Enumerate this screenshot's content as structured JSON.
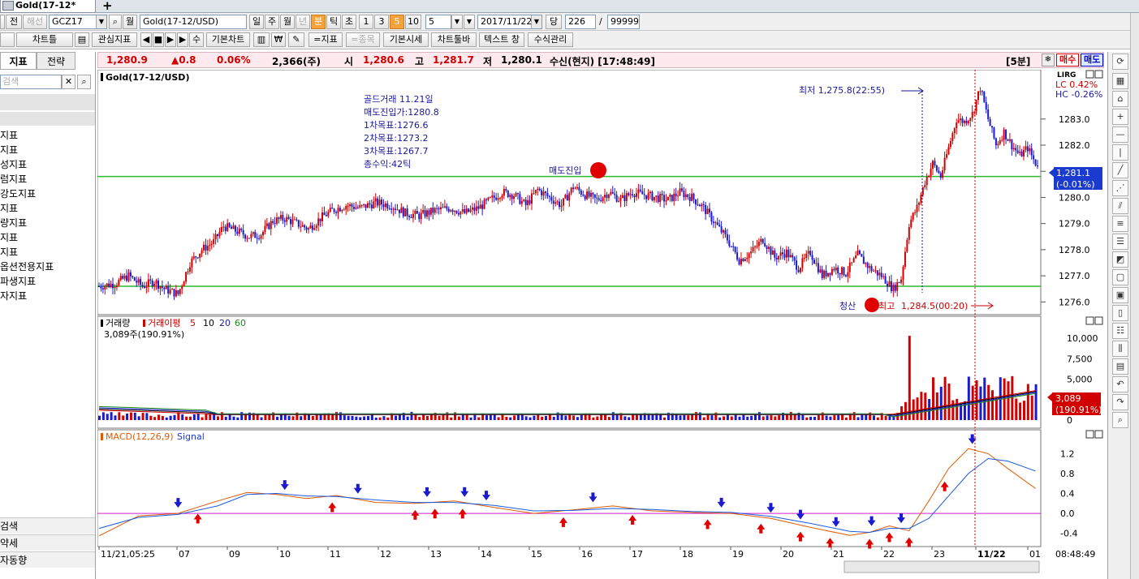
{
  "window": {
    "tab_title": "Gold(17-12*",
    "new_tab_symbol": "+"
  },
  "toolbar1": {
    "buttons": [
      "전",
      "해선",
      "월",
      "일",
      "주",
      "월",
      "년",
      "분",
      "틱",
      "초",
      "1",
      "3",
      "5",
      "10",
      "당"
    ],
    "symbol_code": "GCZ17",
    "symbol_name": "Gold(17-12/USD)",
    "period_value": "5",
    "date_value": "2017/11/22",
    "count_value": "226",
    "count_sep": "/",
    "max_count": "99999",
    "selected_unit": "분",
    "selected_interval": "5"
  },
  "toolbar2": {
    "buttons": [
      "차트틀",
      "관심지표",
      "수",
      "기본차트",
      "₩",
      "=지표",
      "=종목",
      "기본시세",
      "차트툴바",
      "텍스트 창",
      "수식관리"
    ]
  },
  "quote": {
    "price": "1,280.9",
    "change": "▲0.8",
    "change_pct": "0.06%",
    "volume": "2,366(주)",
    "open_label": "시",
    "open": "1,280.6",
    "high_label": "고",
    "high": "1,281.7",
    "low_label": "저",
    "low": "1,280.1",
    "status": "수신(현지) [17:48:49]",
    "interval_badge": "[5분]",
    "sell_label": "매수",
    "buy_label": "매도"
  },
  "left_panel": {
    "tabs": [
      "지표",
      "전략"
    ],
    "search_placeholder": "검색",
    "items": [
      "지표",
      "지표",
      "성지표",
      "럼지표",
      "강도지표",
      "지표",
      "량지표",
      "지표",
      "지표",
      "옵션전용지표",
      "파생지표",
      "자지표"
    ],
    "bottom_items": [
      "검색",
      "약세",
      "자동향"
    ]
  },
  "chart_header": {
    "symbol_label": "Gold(17-12/USD)",
    "legend_lc": "LC  0.42%",
    "legend_hc": "HC -0.26%",
    "current_price": "1,281.1",
    "current_pct": "(-0.01%)"
  },
  "annotations": {
    "strategy_text": [
      "골드거래  11.21일",
      "매도진입가:1280.8",
      "1차목표:1276.6",
      "2차목표:1273.2",
      "3차목표:1267.7",
      "총수익:42틱"
    ],
    "sell_entry": "매도진입",
    "low_marker": "최저 1,275.8(22:55)",
    "liquidate": "청산",
    "high_marker_prefix": "최고",
    "high_marker": "1,284.5(00:20)"
  },
  "volume_panel": {
    "title": "거래량",
    "ma_label": "거래이평",
    "ma_periods": [
      "5",
      "10",
      "20",
      "60"
    ],
    "value_text": "3,089주(190.91%)",
    "current_value": "3,089",
    "current_pct": "(190.91%)",
    "axis_labels": [
      "10,000",
      "7,500",
      "5,000",
      "2,500",
      "0"
    ]
  },
  "macd_panel": {
    "title": "MACD(12,26,9)",
    "signal_label": "Signal",
    "axis_labels": [
      "1.2",
      "0.8",
      "0.4",
      "0.0",
      "-0.4"
    ]
  },
  "time_axis": {
    "labels": [
      "11/21,05:25",
      "07",
      "09",
      "10",
      "11",
      "12",
      "13",
      "14",
      "15",
      "16",
      "17",
      "18",
      "19",
      "20",
      "21",
      "22",
      "23",
      "11/22",
      "01"
    ],
    "clock": "08:48:49"
  },
  "chart_data": {
    "type": "candlestick",
    "symbol": "Gold(17-12/USD)",
    "interval": "5분",
    "price_axis": [
      1276.0,
      1277.0,
      1278.0,
      1279.0,
      1280.0,
      1281.0,
      1282.0,
      1283.0
    ],
    "ylim": [
      1275.7,
      1284.7
    ],
    "horizontal_lines": [
      1280.8,
      1276.6
    ],
    "close_path": [
      [
        0,
        1276.6
      ],
      [
        8,
        1276.7
      ],
      [
        15,
        1277.0
      ],
      [
        22,
        1276.6
      ],
      [
        28,
        1276.8
      ],
      [
        33,
        1276.5
      ],
      [
        40,
        1276.3
      ],
      [
        46,
        1277.5
      ],
      [
        52,
        1278.0
      ],
      [
        58,
        1278.3
      ],
      [
        63,
        1278.9
      ],
      [
        70,
        1278.7
      ],
      [
        76,
        1278.5
      ],
      [
        82,
        1278.6
      ],
      [
        88,
        1279.1
      ],
      [
        94,
        1279.2
      ],
      [
        100,
        1279.0
      ],
      [
        106,
        1278.8
      ],
      [
        112,
        1279.2
      ],
      [
        118,
        1279.5
      ],
      [
        125,
        1279.7
      ],
      [
        132,
        1279.6
      ],
      [
        140,
        1279.8
      ],
      [
        148,
        1279.7
      ],
      [
        155,
        1279.4
      ],
      [
        162,
        1279.3
      ],
      [
        170,
        1279.5
      ],
      [
        178,
        1279.6
      ],
      [
        185,
        1279.4
      ],
      [
        192,
        1279.6
      ],
      [
        198,
        1279.9
      ],
      [
        204,
        1280.2
      ],
      [
        210,
        1280.1
      ],
      [
        216,
        1279.7
      ],
      [
        222,
        1280.3
      ],
      [
        228,
        1280.0
      ],
      [
        234,
        1279.7
      ],
      [
        240,
        1280.4
      ],
      [
        246,
        1280.1
      ],
      [
        252,
        1279.9
      ],
      [
        258,
        1280.2
      ],
      [
        264,
        1279.9
      ],
      [
        270,
        1280.2
      ],
      [
        276,
        1280.1
      ],
      [
        282,
        1280.0
      ],
      [
        288,
        1279.9
      ],
      [
        294,
        1280.2
      ],
      [
        300,
        1280.0
      ],
      [
        306,
        1279.6
      ],
      [
        312,
        1279.0
      ],
      [
        318,
        1278.4
      ],
      [
        324,
        1277.6
      ],
      [
        330,
        1277.9
      ],
      [
        336,
        1278.4
      ],
      [
        342,
        1277.7
      ],
      [
        348,
        1277.9
      ],
      [
        354,
        1277.3
      ],
      [
        360,
        1277.9
      ],
      [
        366,
        1277.0
      ],
      [
        372,
        1277.3
      ],
      [
        378,
        1277.1
      ],
      [
        384,
        1277.8
      ],
      [
        390,
        1277.3
      ],
      [
        396,
        1277.0
      ],
      [
        402,
        1276.5
      ],
      [
        406,
        1276.9
      ],
      [
        410,
        1279.0
      ],
      [
        414,
        1279.6
      ],
      [
        418,
        1280.6
      ],
      [
        422,
        1281.3
      ],
      [
        426,
        1280.8
      ],
      [
        430,
        1281.9
      ],
      [
        434,
        1283.0
      ],
      [
        438,
        1282.9
      ],
      [
        442,
        1283.2
      ],
      [
        446,
        1284.2
      ],
      [
        450,
        1283.0
      ],
      [
        454,
        1282.0
      ],
      [
        458,
        1282.5
      ],
      [
        462,
        1282.0
      ],
      [
        466,
        1281.6
      ],
      [
        470,
        1281.9
      ],
      [
        474,
        1281.3
      ]
    ],
    "volume_axis": [
      0,
      2500,
      5000,
      7500,
      10000
    ],
    "volume_current": 3089,
    "macd_axis": [
      -0.4,
      0.0,
      0.4,
      0.8,
      1.2
    ],
    "macd": [
      [
        0,
        -0.45
      ],
      [
        20,
        -0.05
      ],
      [
        40,
        0.0
      ],
      [
        60,
        0.25
      ],
      [
        75,
        0.42
      ],
      [
        90,
        0.38
      ],
      [
        105,
        0.3
      ],
      [
        120,
        0.36
      ],
      [
        140,
        0.22
      ],
      [
        160,
        0.2
      ],
      [
        180,
        0.25
      ],
      [
        200,
        0.12
      ],
      [
        220,
        0.0
      ],
      [
        240,
        0.07
      ],
      [
        260,
        0.15
      ],
      [
        280,
        0.05
      ],
      [
        300,
        0.02
      ],
      [
        320,
        0.0
      ],
      [
        340,
        -0.1
      ],
      [
        360,
        -0.28
      ],
      [
        380,
        -0.44
      ],
      [
        390,
        -0.38
      ],
      [
        400,
        -0.25
      ],
      [
        410,
        -0.35
      ],
      [
        420,
        0.25
      ],
      [
        430,
        0.9
      ],
      [
        440,
        1.3
      ],
      [
        450,
        1.2
      ],
      [
        460,
        0.9
      ],
      [
        474,
        0.5
      ]
    ],
    "signal": [
      [
        0,
        -0.3
      ],
      [
        20,
        -0.08
      ],
      [
        40,
        -0.02
      ],
      [
        60,
        0.15
      ],
      [
        75,
        0.38
      ],
      [
        90,
        0.4
      ],
      [
        105,
        0.35
      ],
      [
        120,
        0.34
      ],
      [
        140,
        0.27
      ],
      [
        160,
        0.22
      ],
      [
        180,
        0.22
      ],
      [
        200,
        0.16
      ],
      [
        220,
        0.05
      ],
      [
        240,
        0.06
      ],
      [
        260,
        0.1
      ],
      [
        280,
        0.08
      ],
      [
        300,
        0.04
      ],
      [
        320,
        0.02
      ],
      [
        340,
        -0.06
      ],
      [
        360,
        -0.2
      ],
      [
        380,
        -0.36
      ],
      [
        390,
        -0.38
      ],
      [
        400,
        -0.3
      ],
      [
        410,
        -0.3
      ],
      [
        420,
        -0.1
      ],
      [
        430,
        0.35
      ],
      [
        440,
        0.8
      ],
      [
        450,
        1.1
      ],
      [
        460,
        1.05
      ],
      [
        474,
        0.85
      ]
    ]
  }
}
